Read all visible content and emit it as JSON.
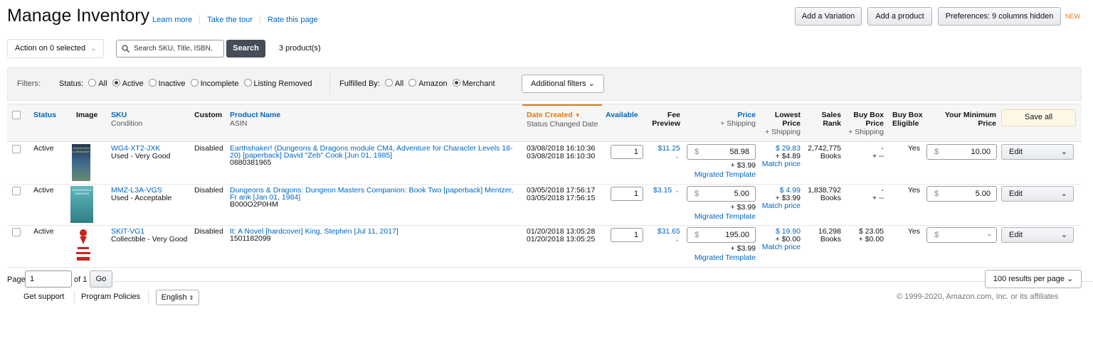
{
  "header": {
    "title": "Manage Inventory",
    "links": [
      "Learn more",
      "Take the tour",
      "Rate this page"
    ],
    "add_variation": "Add a Variation",
    "add_product": "Add a product",
    "preferences": "Preferences: 9 columns hidden",
    "new_tag": "NEW"
  },
  "toolbar": {
    "action_select": "Action on 0 selected",
    "search_placeholder": "Search SKU, Title, ISBN,",
    "search_button": "Search",
    "product_count": "3 product(s)"
  },
  "filters": {
    "label": "Filters:",
    "status_label": "Status:",
    "status_options": [
      "All",
      "Active",
      "Inactive",
      "Incomplete",
      "Listing Removed"
    ],
    "status_selected": "Active",
    "fulfilled_label": "Fulfilled By:",
    "fulfilled_options": [
      "All",
      "Amazon",
      "Merchant"
    ],
    "fulfilled_selected": "Merchant",
    "additional": "Additional filters"
  },
  "columns": {
    "status": "Status",
    "image": "Image",
    "sku": "SKU",
    "condition": "Condition",
    "custom": "Custom",
    "product_name": "Product Name",
    "asin": "ASIN",
    "date_created": "Date Created",
    "status_changed": "Status Changed Date",
    "available": "Available",
    "fee1": "Fee",
    "fee2": "Preview",
    "price": "Price",
    "plus_shipping": "+ Shipping",
    "lowest1": "Lowest",
    "lowest2": "Price",
    "lowest3": "+ Shipping",
    "sales1": "Sales",
    "sales2": "Rank",
    "buybox1": "Buy Box",
    "buybox2": "Price",
    "buybox3": "+ Shipping",
    "eligible1": "Buy Box",
    "eligible2": "Eligible",
    "minprice1": "Your Minimum",
    "minprice2": "Price",
    "save_all": "Save all"
  },
  "rows": [
    {
      "status": "Active",
      "sku": "WG4-XT2-JXK",
      "condition": "Used - Very Good",
      "custom": "Disabled",
      "name": "Earthshaker! (Dungeons & Dragons module CM4, Adventure for Character Levels 18-20) [paperback] David \"Zeb\" Cook [Jun 01, 1985]",
      "asin": "0880381965",
      "date_created": "03/08/2018 16:10:36",
      "date_changed": "03/08/2018 16:10:30",
      "available": "1",
      "fee": "$11.25",
      "currency": "$",
      "price": "58.98",
      "shipping": "+ $3.99",
      "template": "Migrated Template",
      "lowest": "$ 29.83",
      "lowest_ship": "+ $4.89",
      "match": "Match price",
      "rank": "2,742,775",
      "rank_cat": "Books",
      "bb_price": "-",
      "bb_ship": "+ --",
      "eligible": "Yes",
      "min_price": "10.00",
      "edit": "Edit"
    },
    {
      "status": "Active",
      "sku": "MMZ-L3A-VGS",
      "condition": "Used - Acceptable",
      "custom": "Disabled",
      "name": "Dungeons & Dragons: Dungeon Masters Companion: Book Two [paperback] Mentzer, Fr ank [Jan 01, 1984]",
      "asin": "B000O2P0HM",
      "date_created": "03/05/2018 17:56:17",
      "date_changed": "03/05/2018 17:56:15",
      "available": "1",
      "fee": "$3.15",
      "currency": "$",
      "price": "5.00",
      "shipping": "+ $3.99",
      "template": "Migrated Template",
      "lowest": "$ 4.99",
      "lowest_ship": "+ $3.99",
      "match": "Match price",
      "rank": "1,838,792",
      "rank_cat": "Books",
      "bb_price": "-",
      "bb_ship": "+ --",
      "eligible": "Yes",
      "min_price": "5.00",
      "edit": "Edit"
    },
    {
      "status": "Active",
      "sku": "SKIT-VG1",
      "condition": "Collectible - Very Good",
      "custom": "Disabled",
      "name": "It: A Novel [hardcover] King, Stephen [Jul 11, 2017]",
      "asin": "1501182099",
      "date_created": "01/20/2018 13:05:28",
      "date_changed": "01/20/2018 13:05:25",
      "available": "1",
      "fee": "$31.65",
      "currency": "$",
      "price": "195.00",
      "shipping": "+ $3.99",
      "template": "Migrated Template",
      "lowest": "$ 19.90",
      "lowest_ship": "+ $0.00",
      "match": "Match price",
      "rank": "16,298",
      "rank_cat": "Books",
      "bb_price": "$ 23.05",
      "bb_ship": "+ $0.00",
      "eligible": "Yes",
      "min_price": "-",
      "edit": "Edit"
    }
  ],
  "pagination": {
    "page_label": "Page",
    "page_value": "1",
    "of_label": "of 1",
    "go": "Go",
    "per_page": "100 results per page"
  },
  "footer": {
    "support": "Get support",
    "policies": "Program Policies",
    "language": "English",
    "copyright": "© 1999-2020, Amazon.com, Inc. or its affiliates"
  },
  "thumbnails": {
    "row1": {
      "text": "DUNGEONS & DRAGONS",
      "color": "#2f4a6b"
    },
    "row2": {
      "text": "DUNGEONS & DRAGONS",
      "color": "#4aa3a8"
    },
    "row3": {
      "text": "IT STEPHEN KING",
      "color": "#c8241e"
    }
  },
  "icons": [
    "search-icon",
    "chevron-down-icon",
    "sort-down-icon",
    "radio-icon",
    "checkbox-icon"
  ]
}
